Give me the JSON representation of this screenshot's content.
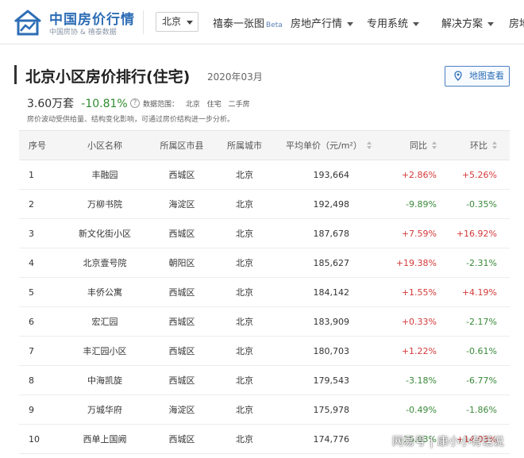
{
  "header": {
    "logo_title": "中国房价行情",
    "logo_sub": "中国房协 & 禧泰数据",
    "city": "北京",
    "nav": [
      {
        "label": "禧泰一张图",
        "badge": "Beta",
        "dropdown": false
      },
      {
        "label": "房地产行情",
        "badge": "",
        "dropdown": true
      },
      {
        "label": "专用系统",
        "badge": "",
        "dropdown": true
      },
      {
        "label": "解决方案",
        "badge": "",
        "dropdown": true
      },
      {
        "label": "房地",
        "badge": "",
        "dropdown": false
      }
    ]
  },
  "main": {
    "title": "北京小区房价排行(住宅)",
    "date": "2020年03月",
    "map_button": "地图查看",
    "avg_price": "3.60万套",
    "avg_change": "-10.81%",
    "scope_label": "数据范围：",
    "scope_tags": [
      "北京",
      "住宅",
      "二手房"
    ],
    "note": "房价波动受供给量、结构变化影响，可通过房价结构进一步分析。"
  },
  "table": {
    "headers": {
      "idx": "序号",
      "name": "小区名称",
      "district": "所属区市县",
      "city": "所属城市",
      "price": "平均单价（元/m²）",
      "yoy": "同比",
      "mom": "环比"
    },
    "rows": [
      {
        "idx": "1",
        "name": "丰融园",
        "district": "西城区",
        "city": "北京",
        "price": "193,664",
        "yoy": "+2.86%",
        "mom": "+5.26%"
      },
      {
        "idx": "2",
        "name": "万柳书院",
        "district": "海淀区",
        "city": "北京",
        "price": "192,498",
        "yoy": "-9.89%",
        "mom": "-0.35%"
      },
      {
        "idx": "3",
        "name": "新文化街小区",
        "district": "西城区",
        "city": "北京",
        "price": "187,678",
        "yoy": "+7.59%",
        "mom": "+16.92%"
      },
      {
        "idx": "4",
        "name": "北京壹号院",
        "district": "朝阳区",
        "city": "北京",
        "price": "185,627",
        "yoy": "+19.38%",
        "mom": "-2.31%"
      },
      {
        "idx": "5",
        "name": "丰侨公寓",
        "district": "西城区",
        "city": "北京",
        "price": "184,142",
        "yoy": "+1.55%",
        "mom": "+4.19%"
      },
      {
        "idx": "6",
        "name": "宏汇园",
        "district": "西城区",
        "city": "北京",
        "price": "183,909",
        "yoy": "+0.33%",
        "mom": "-2.17%"
      },
      {
        "idx": "7",
        "name": "丰汇园小区",
        "district": "西城区",
        "city": "北京",
        "price": "180,703",
        "yoy": "+1.22%",
        "mom": "-0.61%"
      },
      {
        "idx": "8",
        "name": "中海凯旋",
        "district": "西城区",
        "city": "北京",
        "price": "179,543",
        "yoy": "-3.18%",
        "mom": "-6.77%"
      },
      {
        "idx": "9",
        "name": "万城华府",
        "district": "海淀区",
        "city": "北京",
        "price": "175,978",
        "yoy": "-0.49%",
        "mom": "-1.86%"
      },
      {
        "idx": "10",
        "name": "西单上国阙",
        "district": "西城区",
        "city": "北京",
        "price": "174,776",
        "yoy": "-15.03%",
        "mom": "+14.03%"
      }
    ]
  },
  "watermark": {
    "source": "网易号",
    "author": "康小小有话说"
  },
  "colors": {
    "brand": "#2d6db5",
    "positive": "#d43a3a",
    "negative": "#3a8a3a"
  }
}
